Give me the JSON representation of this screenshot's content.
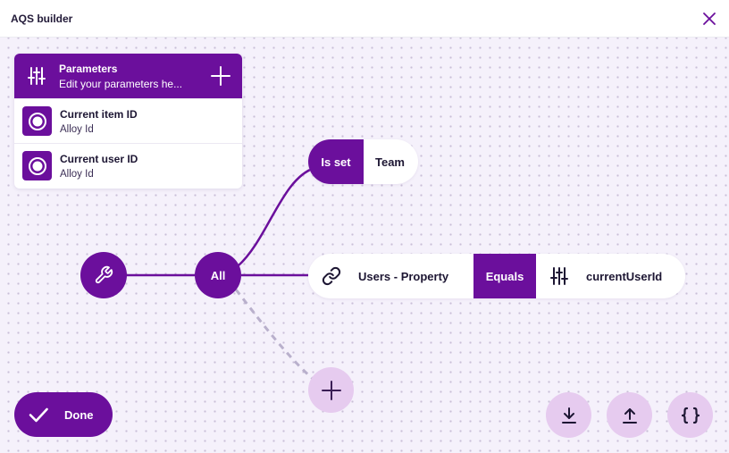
{
  "window": {
    "title": "AQS builder",
    "close_icon": "close-icon"
  },
  "parameters_panel": {
    "title": "Parameters",
    "subtitle": "Edit your parameters he...",
    "header_icon": "sliders-icon",
    "add_icon": "plus-icon",
    "items": [
      {
        "name": "Current item ID",
        "type": "Alloy Id",
        "icon": "radio-target-icon"
      },
      {
        "name": "Current user ID",
        "type": "Alloy Id",
        "icon": "radio-target-icon"
      }
    ]
  },
  "query_tree": {
    "root_icon": "wrench-icon",
    "group_label": "All",
    "conditions": [
      {
        "operator": "Is set",
        "value": "Team"
      },
      {
        "property_icon": "link-icon",
        "property": "Users - Property",
        "operator": "Equals",
        "value_icon": "sliders-icon",
        "value": "currentUserId"
      }
    ],
    "add_icon": "plus-icon"
  },
  "actions": {
    "done_label": "Done",
    "done_icon": "check-icon",
    "download_icon": "download-icon",
    "upload_icon": "upload-icon",
    "json_label": "{}",
    "json_icon": "braces-icon"
  },
  "colors": {
    "accent": "#6b0f9c",
    "accent_light": "#e6cbef",
    "canvas_bg": "#f5f1fb",
    "dashed_edge": "#b9b0cc"
  }
}
